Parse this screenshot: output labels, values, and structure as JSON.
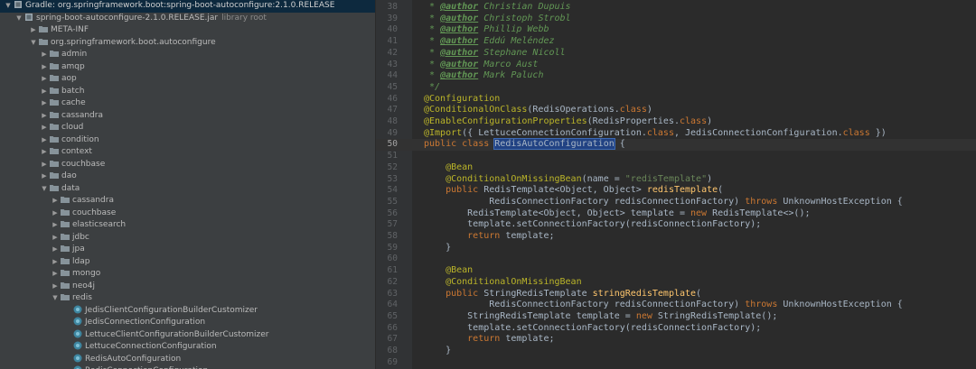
{
  "project_tree": {
    "root_label": "Gradle: org.springframework.boot:spring-boot-autoconfigure:2.1.0.RELEASE",
    "jar_label": "spring-boot-autoconfigure-2.1.0.RELEASE.jar",
    "jar_suffix": "library root",
    "meta_inf": "META-INF",
    "package_label": "org.springframework.boot.autoconfigure",
    "packages": [
      "admin",
      "amqp",
      "aop",
      "batch",
      "cache",
      "cassandra",
      "cloud",
      "condition",
      "context",
      "couchbase",
      "dao"
    ],
    "data_folder": "data",
    "data_packages": [
      "cassandra",
      "couchbase",
      "elasticsearch",
      "jdbc",
      "jpa",
      "ldap",
      "mongo",
      "neo4j"
    ],
    "redis_folder": "redis",
    "redis_classes": [
      "JedisClientConfigurationBuilderCustomizer",
      "JedisConnectionConfiguration",
      "LettuceClientConfigurationBuilderCustomizer",
      "LettuceConnectionConfiguration",
      "RedisAutoConfiguration",
      "RedisConnectionConfiguration"
    ]
  },
  "editor": {
    "current_line": "50",
    "lines": [
      {
        "n": "38",
        "segs": [
          {
            "t": " * ",
            "c": "cmt"
          },
          {
            "t": "@author",
            "c": "tag"
          },
          {
            "t": " Christian Dupuis",
            "c": "cmt"
          }
        ]
      },
      {
        "n": "39",
        "segs": [
          {
            "t": " * ",
            "c": "cmt"
          },
          {
            "t": "@author",
            "c": "tag"
          },
          {
            "t": " Christoph Strobl",
            "c": "cmt"
          }
        ]
      },
      {
        "n": "40",
        "segs": [
          {
            "t": " * ",
            "c": "cmt"
          },
          {
            "t": "@author",
            "c": "tag"
          },
          {
            "t": " Phillip Webb",
            "c": "cmt"
          }
        ]
      },
      {
        "n": "41",
        "segs": [
          {
            "t": " * ",
            "c": "cmt"
          },
          {
            "t": "@author",
            "c": "tag"
          },
          {
            "t": " Eddú Meléndez",
            "c": "cmt"
          }
        ]
      },
      {
        "n": "42",
        "segs": [
          {
            "t": " * ",
            "c": "cmt"
          },
          {
            "t": "@author",
            "c": "tag"
          },
          {
            "t": " Stephane Nicoll",
            "c": "cmt"
          }
        ]
      },
      {
        "n": "43",
        "segs": [
          {
            "t": " * ",
            "c": "cmt"
          },
          {
            "t": "@author",
            "c": "tag"
          },
          {
            "t": " Marco Aust",
            "c": "cmt"
          }
        ]
      },
      {
        "n": "44",
        "segs": [
          {
            "t": " * ",
            "c": "cmt"
          },
          {
            "t": "@author",
            "c": "tag"
          },
          {
            "t": " Mark Paluch",
            "c": "cmt"
          }
        ]
      },
      {
        "n": "45",
        "segs": [
          {
            "t": " */",
            "c": "cmt"
          }
        ]
      },
      {
        "n": "46",
        "segs": [
          {
            "t": "@Configuration",
            "c": "ann"
          }
        ]
      },
      {
        "n": "47",
        "segs": [
          {
            "t": "@ConditionalOnClass",
            "c": "ann"
          },
          {
            "t": "(RedisOperations.",
            "c": ""
          },
          {
            "t": "class",
            "c": "kw"
          },
          {
            "t": ")",
            "c": ""
          }
        ]
      },
      {
        "n": "48",
        "segs": [
          {
            "t": "@EnableConfigurationProperties",
            "c": "ann"
          },
          {
            "t": "(RedisProperties.",
            "c": ""
          },
          {
            "t": "class",
            "c": "kw"
          },
          {
            "t": ")",
            "c": ""
          }
        ]
      },
      {
        "n": "49",
        "segs": [
          {
            "t": "@Import",
            "c": "ann"
          },
          {
            "t": "({ LettuceConnectionConfiguration.",
            "c": ""
          },
          {
            "t": "class",
            "c": "kw"
          },
          {
            "t": ", JedisConnectionConfiguration.",
            "c": ""
          },
          {
            "t": "class",
            "c": "kw"
          },
          {
            "t": " })",
            "c": ""
          }
        ]
      },
      {
        "n": "50",
        "segs": [
          {
            "t": "public class ",
            "c": "kw"
          },
          {
            "t": "RedisAutoConfiguration",
            "c": "hl"
          },
          {
            "t": " {",
            "c": ""
          }
        ]
      },
      {
        "n": "51",
        "segs": []
      },
      {
        "n": "52",
        "segs": [
          {
            "t": "    @Bean",
            "c": "ann"
          }
        ]
      },
      {
        "n": "53",
        "segs": [
          {
            "t": "    @ConditionalOnMissingBean",
            "c": "ann"
          },
          {
            "t": "(name = ",
            "c": ""
          },
          {
            "t": "\"redisTemplate\"",
            "c": "str"
          },
          {
            "t": ")",
            "c": ""
          }
        ]
      },
      {
        "n": "54",
        "segs": [
          {
            "t": "    public ",
            "c": "kw"
          },
          {
            "t": "RedisTemplate<Object, Object> ",
            "c": ""
          },
          {
            "t": "redisTemplate",
            "c": "fn"
          },
          {
            "t": "(",
            "c": ""
          }
        ]
      },
      {
        "n": "55",
        "segs": [
          {
            "t": "            RedisConnectionFactory redisConnectionFactory) ",
            "c": ""
          },
          {
            "t": "throws ",
            "c": "kw"
          },
          {
            "t": "UnknownHostException {",
            "c": ""
          }
        ]
      },
      {
        "n": "56",
        "segs": [
          {
            "t": "        RedisTemplate<Object, Object> template = ",
            "c": ""
          },
          {
            "t": "new ",
            "c": "kw"
          },
          {
            "t": "RedisTemplate<>();",
            "c": ""
          }
        ]
      },
      {
        "n": "57",
        "segs": [
          {
            "t": "        template.setConnectionFactory(redisConnectionFactory);",
            "c": ""
          }
        ]
      },
      {
        "n": "58",
        "segs": [
          {
            "t": "        return ",
            "c": "kw"
          },
          {
            "t": "template;",
            "c": ""
          }
        ]
      },
      {
        "n": "59",
        "segs": [
          {
            "t": "    }",
            "c": ""
          }
        ]
      },
      {
        "n": "60",
        "segs": []
      },
      {
        "n": "61",
        "segs": [
          {
            "t": "    @Bean",
            "c": "ann"
          }
        ]
      },
      {
        "n": "62",
        "segs": [
          {
            "t": "    @ConditionalOnMissingBean",
            "c": "ann"
          }
        ]
      },
      {
        "n": "63",
        "segs": [
          {
            "t": "    public ",
            "c": "kw"
          },
          {
            "t": "StringRedisTemplate ",
            "c": ""
          },
          {
            "t": "stringRedisTemplate",
            "c": "fn"
          },
          {
            "t": "(",
            "c": ""
          }
        ]
      },
      {
        "n": "64",
        "segs": [
          {
            "t": "            RedisConnectionFactory redisConnectionFactory) ",
            "c": ""
          },
          {
            "t": "throws ",
            "c": "kw"
          },
          {
            "t": "UnknownHostException {",
            "c": ""
          }
        ]
      },
      {
        "n": "65",
        "segs": [
          {
            "t": "        StringRedisTemplate template = ",
            "c": ""
          },
          {
            "t": "new ",
            "c": "kw"
          },
          {
            "t": "StringRedisTemplate();",
            "c": ""
          }
        ]
      },
      {
        "n": "66",
        "segs": [
          {
            "t": "        template.setConnectionFactory(redisConnectionFactory);",
            "c": ""
          }
        ]
      },
      {
        "n": "67",
        "segs": [
          {
            "t": "        return ",
            "c": "kw"
          },
          {
            "t": "template;",
            "c": ""
          }
        ]
      },
      {
        "n": "68",
        "segs": [
          {
            "t": "    }",
            "c": ""
          }
        ]
      },
      {
        "n": "69",
        "segs": []
      }
    ]
  },
  "colors": {
    "tree_bg": "#3c3f41",
    "editor_bg": "#2b2b2b",
    "selection": "#0d293e",
    "comment": "#629755",
    "annotation": "#bbb529",
    "keyword": "#cc7832",
    "string": "#6a8759",
    "method": "#ffc66d"
  }
}
